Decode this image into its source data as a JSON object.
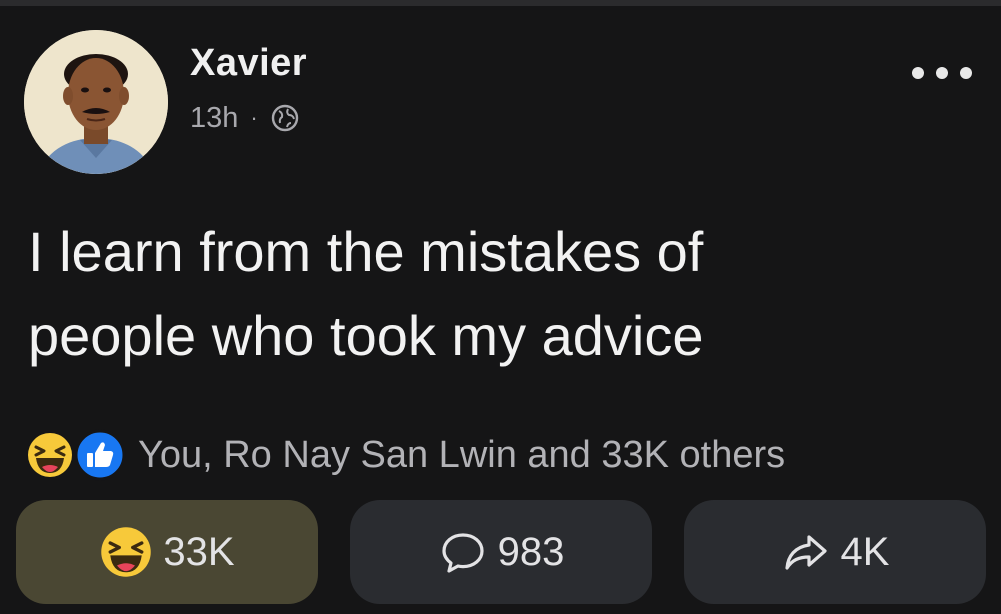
{
  "post": {
    "author": {
      "name": "Xavier",
      "timestamp": "13h",
      "separator": "·",
      "audience_icon": "globe-icon"
    },
    "more_icon": "more-options-icon",
    "text_lines": [
      "I learn from the mistakes of",
      "people who took my advice"
    ],
    "reactions": {
      "icons": [
        "haha-reaction-icon",
        "like-reaction-icon"
      ],
      "summary": "You, Ro Nay San Lwin and 33K others"
    },
    "actions": {
      "haha": {
        "icon": "haha-reaction-icon",
        "count": "33K"
      },
      "comment": {
        "icon": "comment-icon",
        "count": "983"
      },
      "share": {
        "icon": "share-icon",
        "count": "4K"
      }
    }
  },
  "colors": {
    "background": "#151516",
    "text": "#f2f2f2",
    "muted": "#a8a8ad",
    "reacted_button": "#4a4733",
    "button": "#2a2c30",
    "like_blue": "#1877f2",
    "haha_yellow": "#f7c93a"
  }
}
